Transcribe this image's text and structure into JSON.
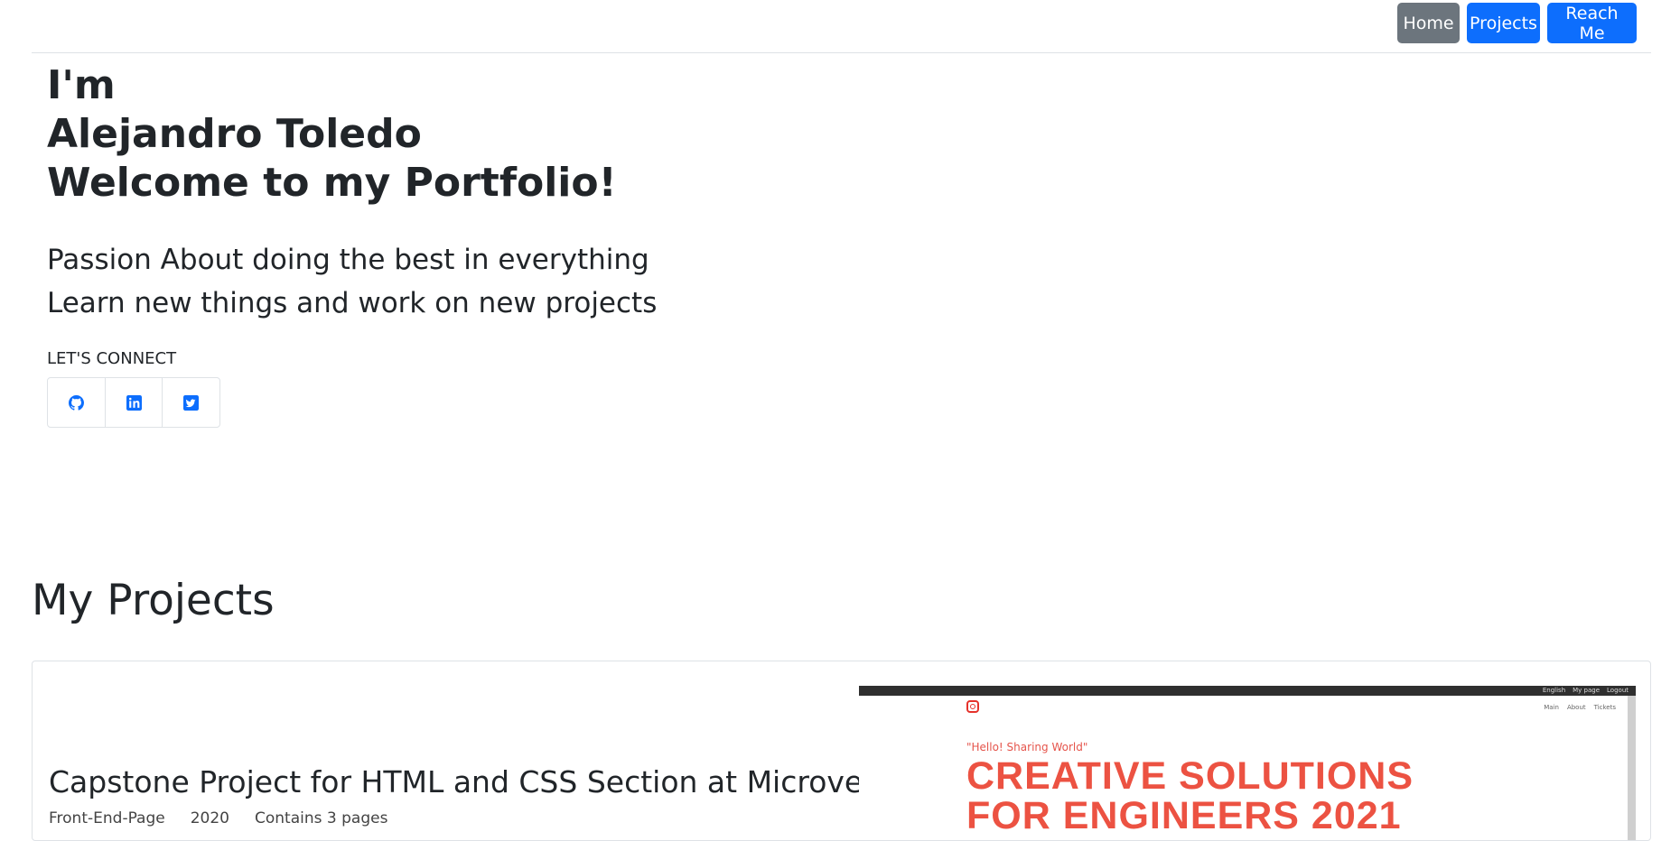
{
  "nav": {
    "home": "Home",
    "projects": "Projects",
    "reach": "Reach Me"
  },
  "hero": {
    "line1": "I'm",
    "line2": "Alejandro Toledo",
    "line3": "Welcome to my Portfolio!"
  },
  "tagline": {
    "line1": "Passion About doing the best in everything",
    "line2": "Learn new things and work on new projects"
  },
  "connect": {
    "label": "LET'S CONNECT",
    "icons": [
      "github-icon",
      "linkedin-icon",
      "twitter-icon"
    ]
  },
  "projects": {
    "title": "My Projects",
    "items": [
      {
        "title": "Capstone Project for HTML and CSS Section at Microverse",
        "meta": [
          "Front-End-Page",
          "2020",
          "Contains 3 pages"
        ],
        "preview": {
          "top_links": [
            "English",
            "My page",
            "Logout"
          ],
          "nav_links": [
            "Main",
            "About",
            "Tickets"
          ],
          "hello": "\"Hello! Sharing World\"",
          "headline_1": "CREATIVE SOLUTIONS",
          "headline_2": "FOR ENGINEERS 2021"
        }
      }
    ]
  },
  "colors": {
    "primary": "#0d6efd",
    "secondary": "#6c757d",
    "accent": "#ec5242"
  }
}
